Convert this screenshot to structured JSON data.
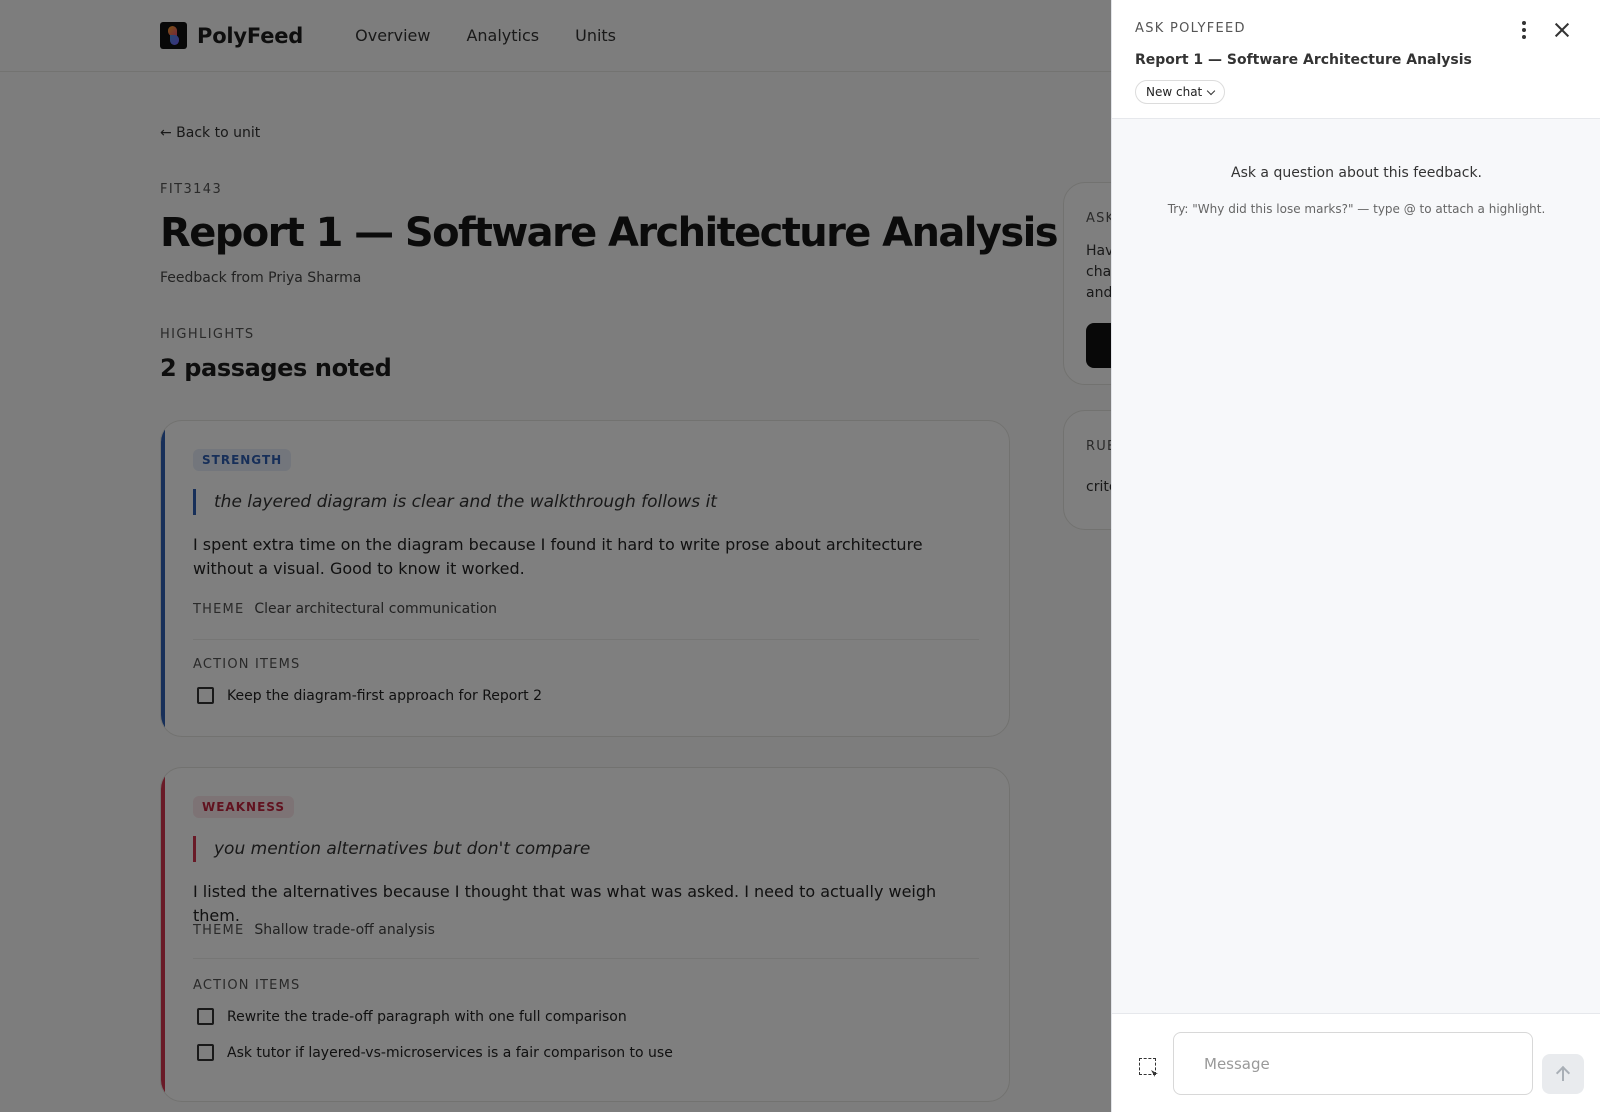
{
  "app": {
    "name": "PolyFeed"
  },
  "nav": {
    "items": [
      "Overview",
      "Analytics",
      "Units"
    ]
  },
  "page": {
    "back_label": "← Back to unit",
    "unit_code": "FIT3143",
    "title": "Report 1 — Software Architecture Analysis",
    "subtitle": "Feedback from Priya Sharma",
    "highlights_label": "HIGHLIGHTS",
    "highlights_count": "2 passages noted"
  },
  "highlights": [
    {
      "tag": "STRENGTH",
      "quote": "the layered diagram is clear and the walkthrough follows it",
      "reply": "I spent extra time on the diagram because I found it hard to write prose about architecture without a visual. Good to know it worked.",
      "theme_label": "THEME",
      "theme": "Clear architectural communication",
      "actions_label": "ACTION ITEMS",
      "actions": [
        "Keep the diagram-first approach for Report 2"
      ]
    },
    {
      "tag": "WEAKNESS",
      "quote": "you mention alternatives but don't compare",
      "reply": "I listed the alternatives because I thought that was what was asked. I need to actually weigh them.",
      "theme_label": "THEME",
      "theme": "Shallow trade-off analysis",
      "actions_label": "ACTION ITEMS",
      "actions": [
        "Rewrite the trade-off paragraph with one full comparison",
        "Ask tutor if layered-vs-microservices is a fair comparison to use"
      ]
    }
  ],
  "side": {
    "ask_label": "ASK",
    "ask_text": [
      "Hav",
      "cha",
      "and"
    ],
    "rubric_label": "RUB",
    "rubric_text": "crite"
  },
  "drawer": {
    "kicker": "ASK POLYFEED",
    "title": "Report 1 — Software Architecture Analysis",
    "new_chat_label": "New chat",
    "empty_title": "Ask a question about this feedback.",
    "empty_hint": "Try: \"Why did this lose marks?\" — type @ to attach a highlight.",
    "message_placeholder": "Message"
  },
  "colors": {
    "strength": "#2f5fb3",
    "weakness": "#d3354e",
    "overlay": "rgba(0,0,0,0.5)"
  }
}
